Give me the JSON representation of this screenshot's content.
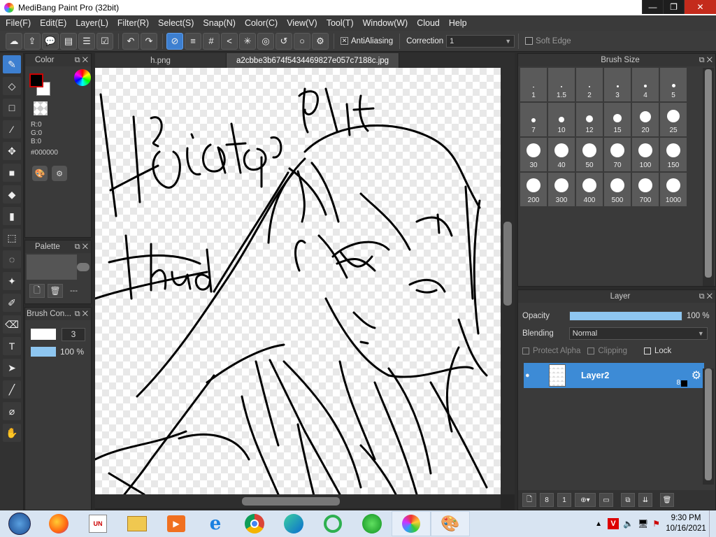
{
  "window": {
    "title": "MediBang Paint Pro (32bit)",
    "minimize": "—",
    "restore": "❐",
    "close": "✕"
  },
  "menu": [
    "File(F)",
    "Edit(E)",
    "Layer(L)",
    "Filter(R)",
    "Select(S)",
    "Snap(N)",
    "Color(C)",
    "View(V)",
    "Tool(T)",
    "Window(W)",
    "Cloud",
    "Help"
  ],
  "toolbar": {
    "antialiasing_label": "AntiAliasing",
    "antialiasing_checked": true,
    "correction_label": "Correction",
    "correction_value": "1",
    "soft_edge_label": "Soft Edge"
  },
  "color_panel": {
    "title": "Color",
    "r": "R:0",
    "g": "G:0",
    "b": "B:0",
    "hex": "#000000",
    "primary_color": "#000000",
    "secondary_color": "#ffffff"
  },
  "palette_panel": {
    "title": "Palette",
    "dashes": "---"
  },
  "brush_control_panel": {
    "title": "Brush Con...",
    "size_value": "3",
    "opacity_value": "100 %"
  },
  "tabs": [
    {
      "label": "h.png",
      "active": false
    },
    {
      "label": "a2cbbe3b674f5434469827e057c7188c.jpg",
      "active": true
    }
  ],
  "brush_size_panel": {
    "title": "Brush Size",
    "sizes": [
      "1",
      "1.5",
      "2",
      "3",
      "4",
      "5",
      "7",
      "10",
      "12",
      "15",
      "20",
      "25",
      "30",
      "40",
      "50",
      "70",
      "100",
      "150",
      "200",
      "300",
      "400",
      "500",
      "700",
      "1000"
    ]
  },
  "layer_panel": {
    "title": "Layer",
    "opacity_label": "Opacity",
    "opacity_value": "100 %",
    "opacity_fraction": 1.0,
    "blending_label": "Blending",
    "blending_value": "Normal",
    "protect_alpha_label": "Protect Alpha",
    "clipping_label": "Clipping",
    "lock_label": "Lock",
    "layer_name": "Layer2",
    "layer_badge": "8"
  },
  "taskbar": {
    "time": "9:30 PM",
    "date": "10/16/2021"
  }
}
